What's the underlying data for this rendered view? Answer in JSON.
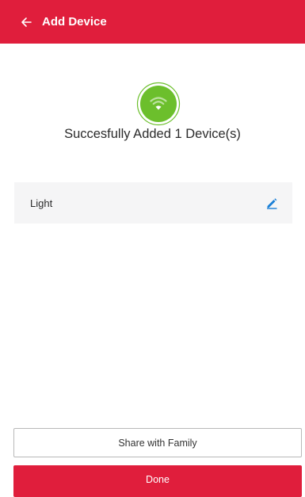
{
  "app_bar": {
    "title": "Add Device",
    "back_icon": "arrow-left-icon",
    "color": "#e01e3c"
  },
  "status": {
    "icon": "wifi-success-icon",
    "icon_color": "#6cbf2c",
    "message": "Succesfully Added 1 Device(s)"
  },
  "devices": [
    {
      "name": "Light",
      "edit_icon": "pencil-icon"
    }
  ],
  "actions": {
    "share_label": "Share with Family",
    "done_label": "Done"
  }
}
